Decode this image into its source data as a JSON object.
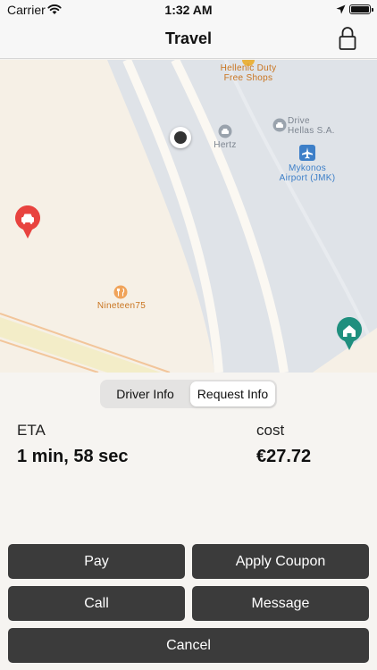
{
  "status_bar": {
    "carrier": "Carrier",
    "time": "1:32 AM"
  },
  "nav": {
    "title": "Travel",
    "lock_icon": "lock-icon"
  },
  "map": {
    "labels": {
      "duty_free": "Hellenic Duty\nFree Shops",
      "hertz": "Hertz",
      "drive_hellas": "Drive\nHellas S.A.",
      "airport": "Mykonos\nAirport (JMK)",
      "restaurant": "Nineteen75"
    },
    "pins": {
      "driver": {
        "icon": "car-icon",
        "color": "#e8433f"
      },
      "home": {
        "icon": "home-icon",
        "color": "#1f8f7e"
      }
    },
    "colors": {
      "land": "#f6f0e6",
      "runway_area": "#dfe3e8",
      "road": "#fbf8f2",
      "airport_blue": "#3d7fc8"
    }
  },
  "segmented": {
    "tab1": "Driver Info",
    "tab2": "Request Info",
    "selected": "Request Info"
  },
  "info": {
    "eta_label": "ETA",
    "eta_value": "1 min, 58 sec",
    "cost_label": "cost",
    "cost_value": "€27.72"
  },
  "buttons": {
    "pay": "Pay",
    "apply_coupon": "Apply Coupon",
    "call": "Call",
    "message": "Message",
    "cancel": "Cancel"
  }
}
